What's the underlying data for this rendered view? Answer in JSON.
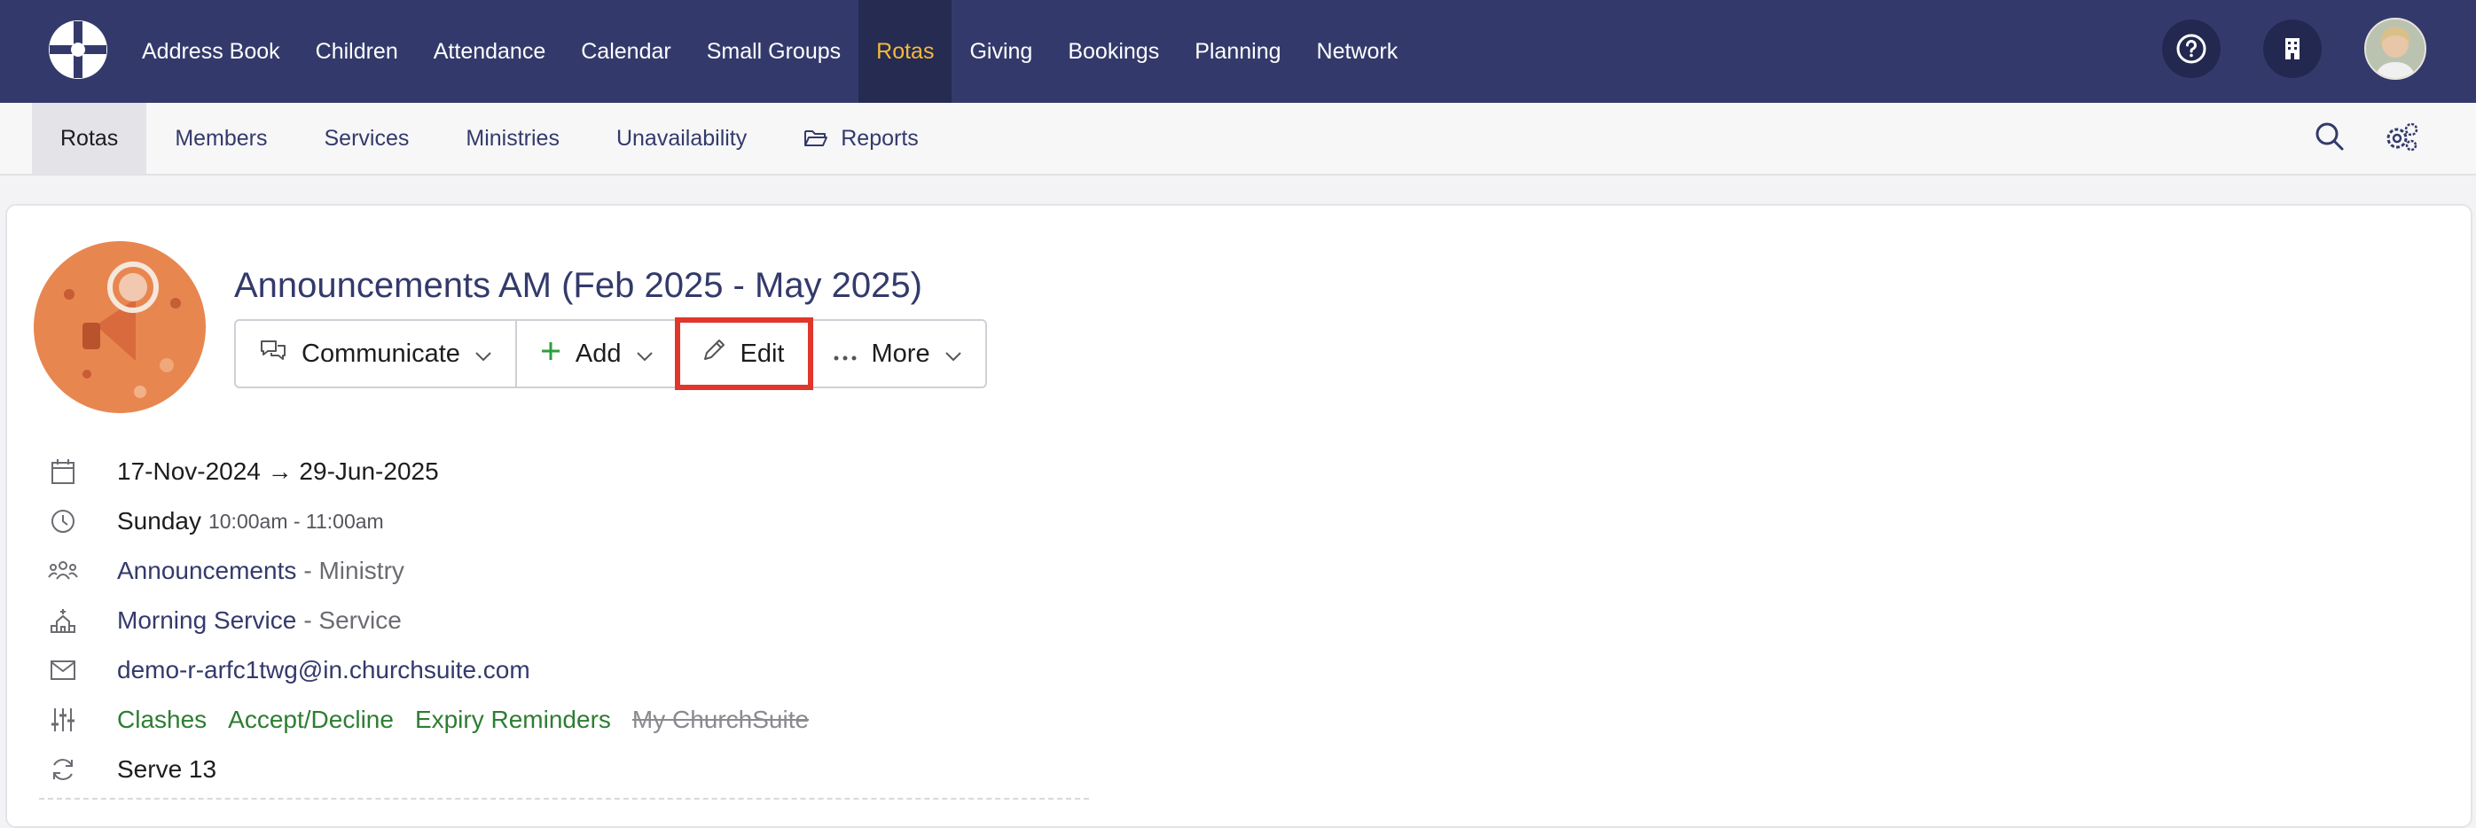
{
  "topnav": {
    "items": [
      {
        "label": "Address Book"
      },
      {
        "label": "Children"
      },
      {
        "label": "Attendance"
      },
      {
        "label": "Calendar"
      },
      {
        "label": "Small Groups"
      },
      {
        "label": "Rotas",
        "active": true
      },
      {
        "label": "Giving"
      },
      {
        "label": "Bookings"
      },
      {
        "label": "Planning"
      },
      {
        "label": "Network"
      }
    ],
    "help_icon": "question-circle-icon",
    "org_icon": "building-icon"
  },
  "subnav": {
    "tabs": [
      {
        "label": "Rotas",
        "active": true
      },
      {
        "label": "Members"
      },
      {
        "label": "Services"
      },
      {
        "label": "Ministries"
      },
      {
        "label": "Unavailability"
      },
      {
        "label": "Reports",
        "icon": "folder-open-icon"
      }
    ]
  },
  "rota": {
    "title": "Announcements AM (Feb 2025 - May 2025)",
    "actions": {
      "communicate": "Communicate",
      "add": "Add",
      "edit": "Edit",
      "more": "More"
    },
    "dates": "17-Nov-2024 → 29-Jun-2025",
    "day": "Sunday",
    "time": "10:00am - 11:00am",
    "ministry_name": "Announcements",
    "ministry_suffix": "- Ministry",
    "service_name": "Morning Service",
    "service_suffix": "- Service",
    "email": "demo-r-arfc1twg@in.churchsuite.com",
    "settings": {
      "clashes": "Clashes",
      "accept_decline": "Accept/Decline",
      "expiry": "Expiry Reminders",
      "my_churchsuite": "My ChurchSuite"
    },
    "serve": "Serve 13"
  },
  "colors": {
    "nav_bg": "#333a6b",
    "active_nav": "#f6b93b",
    "link": "#333a6b",
    "enabled_setting": "#2e7d32",
    "highlight": "#e0362c"
  }
}
